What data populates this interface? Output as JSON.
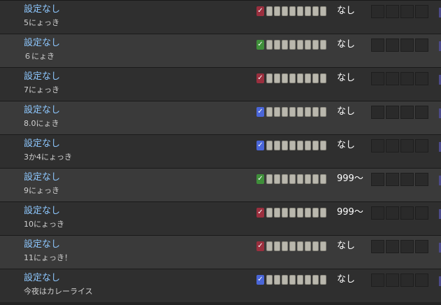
{
  "rows": [
    {
      "title": "設定なし",
      "subtitle": "5にょっき",
      "check_color": "#9a2f3e",
      "value": "なし"
    },
    {
      "title": "設定なし",
      "subtitle": "６にょき",
      "check_color": "#3f8f3a",
      "value": "なし"
    },
    {
      "title": "設定なし",
      "subtitle": "7にょっき",
      "check_color": "#9a2f3e",
      "value": "なし"
    },
    {
      "title": "設定なし",
      "subtitle": "8.0にょき",
      "check_color": "#4a66d8",
      "value": "なし"
    },
    {
      "title": "設定なし",
      "subtitle": "3か4にょっき",
      "check_color": "#4a66d8",
      "value": "なし"
    },
    {
      "title": "設定なし",
      "subtitle": "9にょっき",
      "check_color": "#3f8f3a",
      "value": "999～"
    },
    {
      "title": "設定なし",
      "subtitle": "10にょっき",
      "check_color": "#9a2f3e",
      "value": "999～"
    },
    {
      "title": "設定なし",
      "subtitle": "11にょっき！",
      "check_color": "#9a2f3e",
      "value": "なし"
    },
    {
      "title": "設定なし",
      "subtitle": "今夜はカレーライス",
      "check_color": "#4a66d8",
      "value": "なし"
    }
  ],
  "icons": {
    "check": "✓"
  },
  "colors": {
    "title": "#8ec8ff",
    "box_fill": "#b9b7ad",
    "accent": "#4c4a8a"
  }
}
